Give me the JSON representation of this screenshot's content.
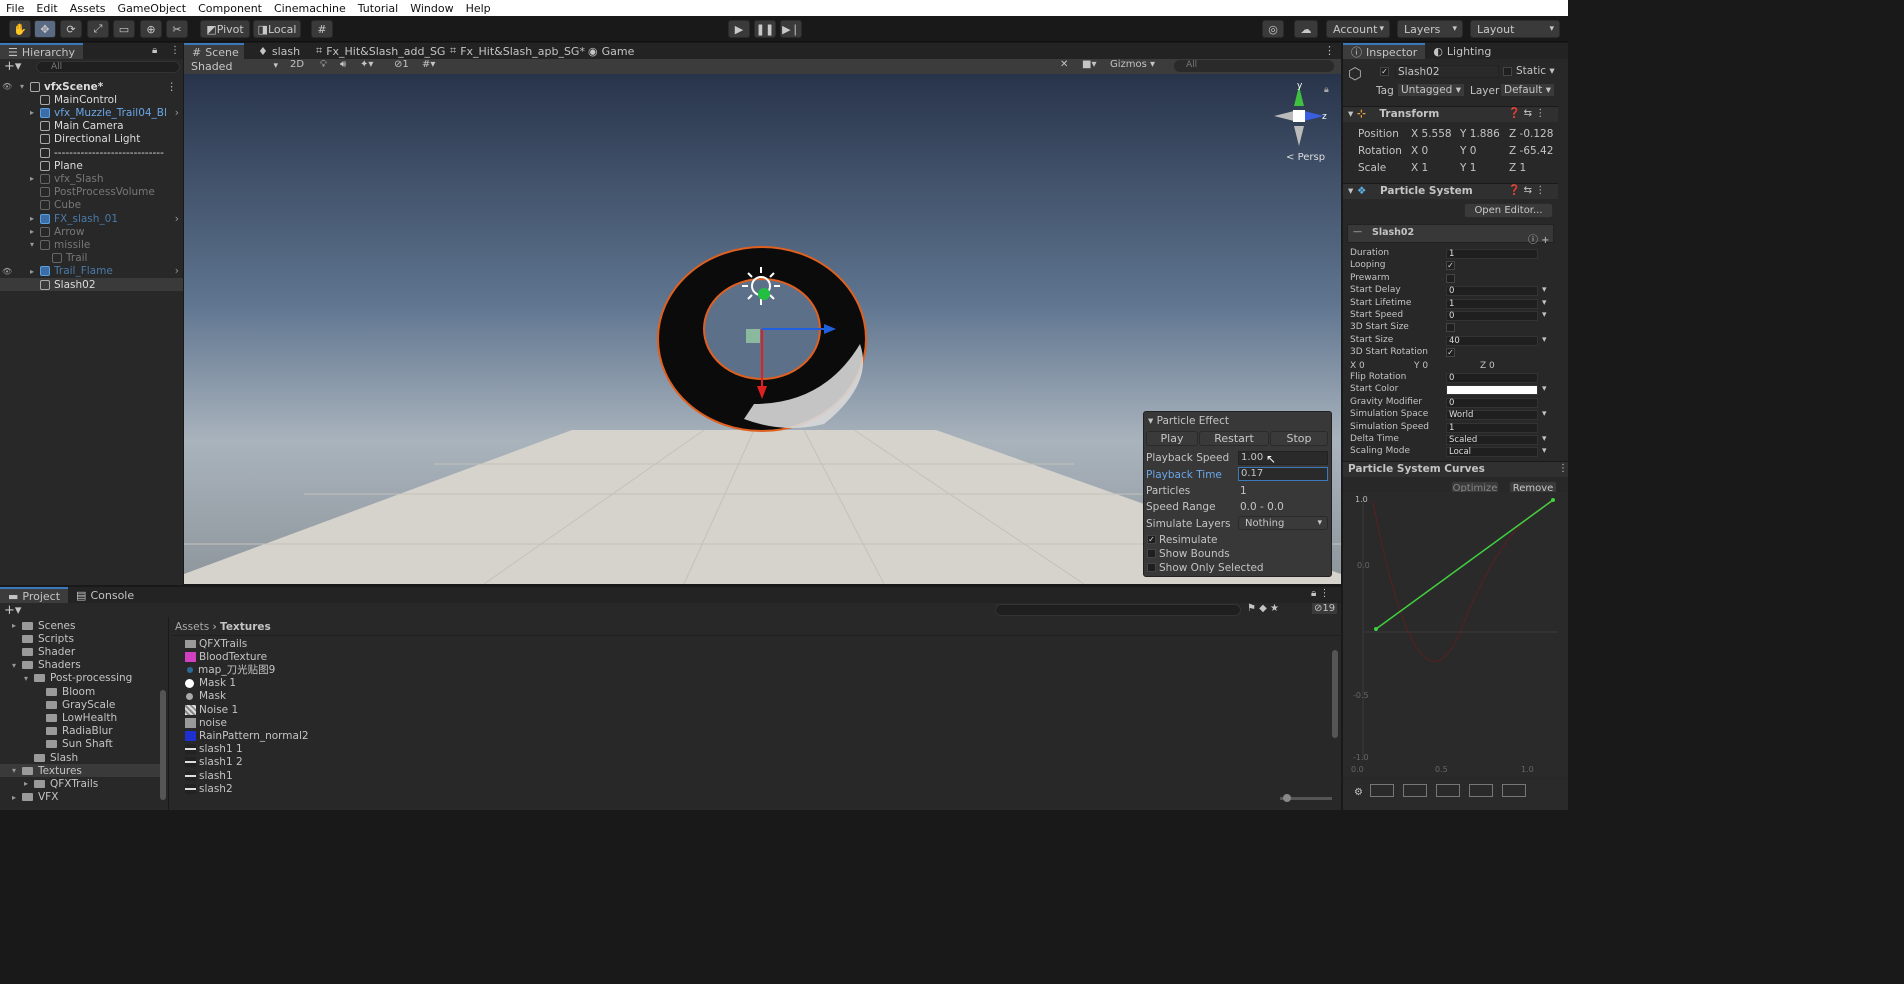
{
  "menu": [
    "File",
    "Edit",
    "Assets",
    "GameObject",
    "Component",
    "Cinemachine",
    "Tutorial",
    "Window",
    "Help"
  ],
  "toolbar": {
    "pivot": "Pivot",
    "local": "Local",
    "account": "Account",
    "layers": "Layers",
    "layout": "Layout"
  },
  "hierarchy": {
    "tab": "Hierarchy",
    "search_placeholder": "All",
    "rows": [
      {
        "label": "vfxScene*"
      },
      {
        "label": "MainControl"
      },
      {
        "label": "vfx_Muzzle_Trail04_Bl"
      },
      {
        "label": "Main Camera"
      },
      {
        "label": "Directional Light"
      },
      {
        "label": "-----------------------------"
      },
      {
        "label": "Plane"
      },
      {
        "label": "vfx_Slash"
      },
      {
        "label": "PostProcessVolume"
      },
      {
        "label": "Cube"
      },
      {
        "label": "FX_slash_01"
      },
      {
        "label": "Arrow"
      },
      {
        "label": "missile"
      },
      {
        "label": "Trail"
      },
      {
        "label": "Trail_Flame"
      },
      {
        "label": "Slash02"
      }
    ]
  },
  "scene_tabs": [
    "Scene",
    "slash",
    "Fx_Hit&Slash_add_SG",
    "Fx_Hit&Slash_apb_SG*",
    "Game"
  ],
  "scene_toolbar": {
    "shading": "Shaded",
    "mode2d": "2D",
    "layers_count": "1",
    "gizmos": "Gizmos",
    "search_placeholder": "All"
  },
  "gizmo": {
    "persp": "Persp",
    "y": "y",
    "z": "z"
  },
  "particle_effect": {
    "title": "Particle Effect",
    "play": "Play",
    "restart": "Restart",
    "stop": "Stop",
    "playback_speed_label": "Playback Speed",
    "playback_speed": "1.00",
    "playback_time_label": "Playback Time",
    "playback_time": "0.17",
    "particles_label": "Particles",
    "particles": "1",
    "speed_range_label": "Speed Range",
    "speed_range": "0.0 - 0.0",
    "simulate_layers_label": "Simulate Layers",
    "simulate_layers": "Nothing",
    "resimulate": "Resimulate",
    "show_bounds": "Show Bounds",
    "show_only_selected": "Show Only Selected"
  },
  "inspector": {
    "tab": "Inspector",
    "lighting_tab": "Lighting",
    "object_name": "Slash02",
    "static": "Static",
    "tag_label": "Tag",
    "tag": "Untagged",
    "layer_label": "Layer",
    "layer": "Default",
    "transform": {
      "title": "Transform",
      "position": {
        "label": "Position",
        "x": "5.558",
        "y": "1.886",
        "z": "-0.128"
      },
      "rotation": {
        "label": "Rotation",
        "x": "0",
        "y": "0",
        "z": "-65.42"
      },
      "scale": {
        "label": "Scale",
        "x": "1",
        "y": "1",
        "z": "1"
      }
    },
    "ps_title": "Particle System",
    "open_editor": "Open Editor...",
    "module": "Slash02",
    "fields": [
      {
        "label": "Duration",
        "value": "1"
      },
      {
        "label": "Looping",
        "value": "✓"
      },
      {
        "label": "Prewarm",
        "value": ""
      },
      {
        "label": "Start Delay",
        "value": "0"
      },
      {
        "label": "Start Lifetime",
        "value": "1"
      },
      {
        "label": "Start Speed",
        "value": "0"
      },
      {
        "label": "3D Start Size",
        "value": ""
      },
      {
        "label": "Start Size",
        "value": "40"
      },
      {
        "label": "3D Start Rotation",
        "value": "✓"
      },
      {
        "label": "",
        "value": ""
      },
      {
        "label": "Flip Rotation",
        "value": "0"
      },
      {
        "label": "Start Color",
        "value": ""
      },
      {
        "label": "Gravity Modifier",
        "value": "0"
      },
      {
        "label": "Simulation Space",
        "value": "World"
      },
      {
        "label": "Simulation Speed",
        "value": "1"
      },
      {
        "label": "Delta Time",
        "value": "Scaled"
      },
      {
        "label": "Scaling Mode",
        "value": "Local"
      }
    ],
    "rot3": {
      "x": "0",
      "y": "0",
      "z": "0"
    },
    "curves_title": "Particle System Curves",
    "optimize": "Optimize",
    "remove": "Remove",
    "curve_axis": {
      "y_top": "1.0",
      "y_mid": "0.0",
      "y_neg": "-0.5",
      "y_bot": "-1.0",
      "x0": "0.0",
      "x1": "0.5",
      "x2": "1.0"
    }
  },
  "project": {
    "tab": "Project",
    "console_tab": "Console",
    "hidden_count": "19",
    "breadcrumb_root": "Assets",
    "breadcrumb_current": "Textures",
    "tree": [
      {
        "label": "Scenes"
      },
      {
        "label": "Scripts"
      },
      {
        "label": "Shader"
      },
      {
        "label": "Shaders"
      },
      {
        "label": "Post-processing"
      },
      {
        "label": "Bloom"
      },
      {
        "label": "GrayScale"
      },
      {
        "label": "LowHealth"
      },
      {
        "label": "RadiaBlur"
      },
      {
        "label": "Sun Shaft"
      },
      {
        "label": "Slash"
      },
      {
        "label": "Textures"
      },
      {
        "label": "QFXTrails"
      },
      {
        "label": "VFX"
      }
    ],
    "assets": [
      {
        "label": "QFXTrails"
      },
      {
        "label": "BloodTexture"
      },
      {
        "label": "map_刀光贴图9"
      },
      {
        "label": "Mask 1"
      },
      {
        "label": "Mask"
      },
      {
        "label": "Noise 1"
      },
      {
        "label": "noise"
      },
      {
        "label": "RainPattern_normal2"
      },
      {
        "label": "slash1 1"
      },
      {
        "label": "slash1 2"
      },
      {
        "label": "slash1"
      },
      {
        "label": "slash2"
      }
    ]
  }
}
